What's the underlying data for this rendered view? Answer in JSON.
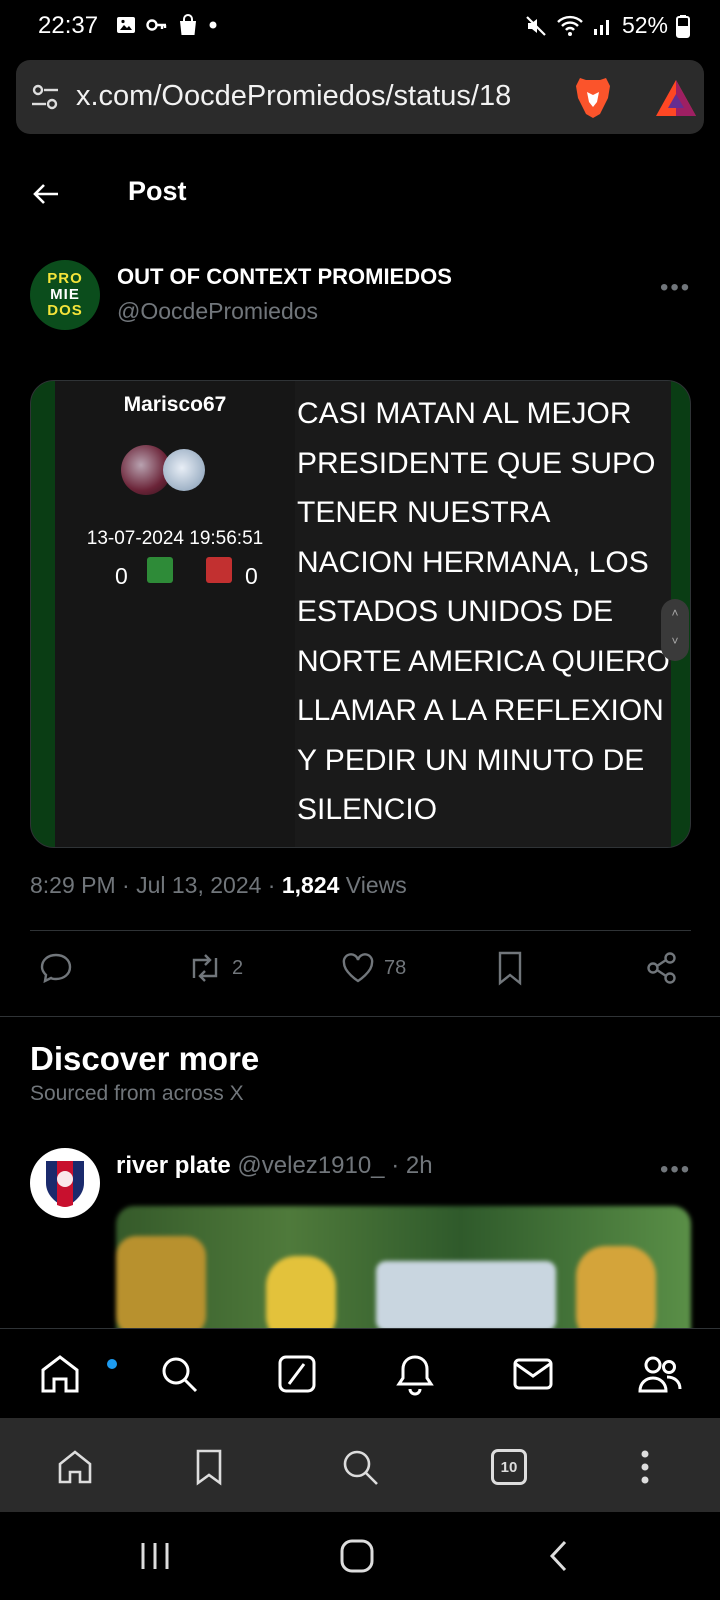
{
  "status_bar": {
    "time": "22:37",
    "battery": "52%"
  },
  "browser": {
    "url": "x.com/OocdePromiedos/status/18"
  },
  "page": {
    "title": "Post"
  },
  "post": {
    "author_name": "OUT OF CONTEXT PROMIEDOS",
    "author_handle": "@OocdePromiedos",
    "avatar_text": [
      "PRO",
      "MIE",
      "DOS"
    ],
    "media": {
      "username": "Marisco67",
      "date": "13-07-2024 19:56:51",
      "votes_up": "0",
      "votes_down": "0",
      "comment": "CASI MATAN AL MEJOR PRESIDENTE QUE SUPO TENER NUESTRA NACION HERMANA, LOS ESTADOS UNIDOS DE NORTE AMERICA QUIERO LLAMAR A LA REFLEXION Y PEDIR UN MINUTO DE SILENCIO"
    },
    "timestamp": "8:29 PM · Jul 13, 2024 · ",
    "views_count": "1,824",
    "views_label": " Views",
    "reposts": "2",
    "likes": "78"
  },
  "discover": {
    "title": "Discover more",
    "subtitle": "Sourced from across X"
  },
  "post2": {
    "name": "river plate",
    "handle": " @velez1910_ · 2h"
  },
  "colors": {
    "accent": "#1d9bf0",
    "muted": "#71767b",
    "background": "#000000"
  }
}
